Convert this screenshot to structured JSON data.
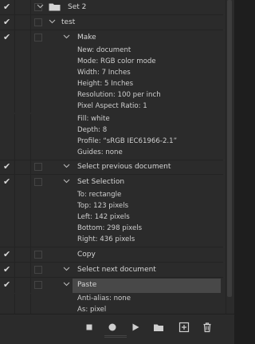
{
  "actions": {
    "set": {
      "label": "Set 2"
    },
    "action": {
      "label": "test"
    },
    "steps": [
      {
        "label": "Make",
        "details": [
          "New: document",
          "Mode: RGB color mode",
          "Width: 7 Inches",
          "Height: 5 Inches",
          "Resolution: 100 per inch",
          "Pixel Aspect Ratio: 1",
          "Fill: white",
          "Depth: 8",
          "Profile:  “sRGB IEC61966-2.1”",
          "Guides: none"
        ]
      },
      {
        "label": "Select previous document"
      },
      {
        "label": "Set Selection",
        "details": [
          "To: rectangle",
          "Top: 123 pixels",
          "Left: 142 pixels",
          "Bottom: 298 pixels",
          "Right: 436 pixels"
        ]
      },
      {
        "label": "Copy"
      },
      {
        "label": "Select next document"
      },
      {
        "label": "Paste",
        "details": [
          "Anti-alias: none",
          "As: pixel"
        ]
      }
    ],
    "check_glyph": "✔"
  },
  "footer": {
    "buttons": [
      "stop-icon",
      "record-icon",
      "play-icon",
      "new-set-folder-icon",
      "new-action-icon",
      "trash-icon"
    ]
  },
  "colors": {
    "panel": "#2b2b2b",
    "highlight": "#484848",
    "text": "#d6d6d6"
  }
}
